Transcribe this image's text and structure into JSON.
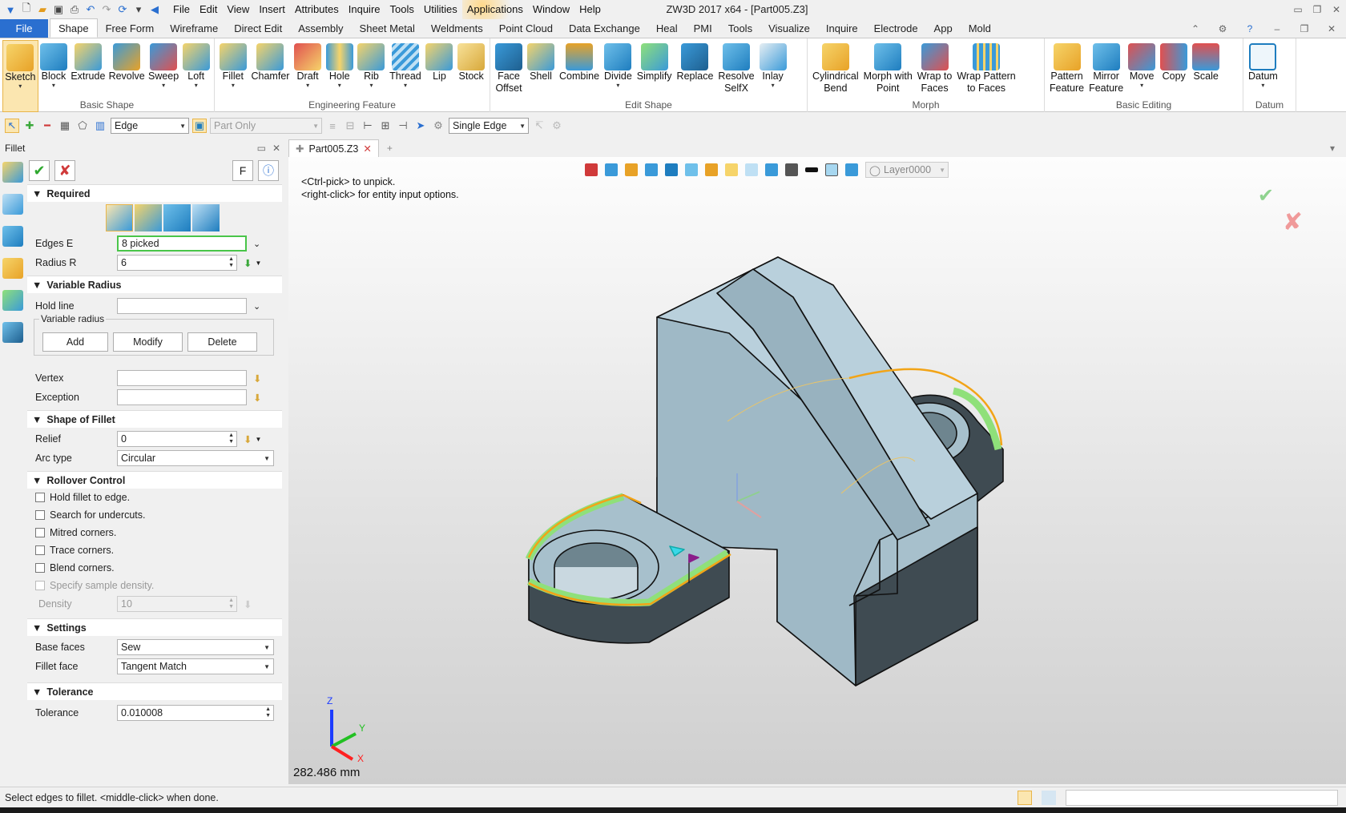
{
  "app": {
    "title": "ZW3D 2017  x64 - [Part005.Z3]",
    "menus": [
      "File",
      "Edit",
      "View",
      "Insert",
      "Attributes",
      "Inquire",
      "Tools",
      "Utilities",
      "Applications",
      "Window",
      "Help"
    ]
  },
  "ribbon_tabs": [
    "File",
    "Shape",
    "Free Form",
    "Wireframe",
    "Direct Edit",
    "Assembly",
    "Sheet Metal",
    "Weldments",
    "Point Cloud",
    "Data Exchange",
    "Heal",
    "PMI",
    "Tools",
    "Visualize",
    "Inquire",
    "Electrode",
    "App",
    "Mold"
  ],
  "ribbon_groups": [
    {
      "label": "Basic Shape",
      "buttons": [
        "Sketch",
        "Block",
        "Extrude",
        "Revolve",
        "Sweep",
        "Loft"
      ]
    },
    {
      "label": "Engineering Feature",
      "buttons": [
        "Fillet",
        "Chamfer",
        "Draft",
        "Hole",
        "Rib",
        "Thread",
        "Lip",
        "Stock"
      ]
    },
    {
      "label": "Edit Shape",
      "buttons": [
        "Face\nOffset",
        "Shell",
        "Combine",
        "Divide",
        "Simplify",
        "Replace",
        "Resolve\nSelfX",
        "Inlay"
      ]
    },
    {
      "label": "Morph",
      "buttons": [
        "Cylindrical\nBend",
        "Morph with\nPoint",
        "Wrap to\nFaces",
        "Wrap Pattern\nto Faces"
      ]
    },
    {
      "label": "Basic Editing",
      "buttons": [
        "Pattern\nFeature",
        "Mirror\nFeature",
        "Move",
        "Copy",
        "Scale"
      ]
    },
    {
      "label": "Datum",
      "buttons": [
        "Datum"
      ]
    }
  ],
  "toolbar": {
    "filter": "Edge",
    "scope": "Part Only",
    "pick_mode": "Single Edge"
  },
  "doc_tab": "Part005.Z3",
  "panel": {
    "title": "Fillet",
    "f_button": "F",
    "sections": {
      "required": "Required",
      "variable_radius": "Variable Radius",
      "shape_of_fillet": "Shape of Fillet",
      "rollover_control": "Rollover Control",
      "settings": "Settings",
      "tolerance": "Tolerance"
    },
    "edges_label": "Edges E",
    "edges_value": "8 picked",
    "radius_label": "Radius R",
    "radius_value": "6",
    "hold_line_label": "Hold line",
    "variable_radius_group": "Variable radius",
    "add": "Add",
    "modify": "Modify",
    "delete": "Delete",
    "vertex_label": "Vertex",
    "exception_label": "Exception",
    "relief_label": "Relief",
    "relief_value": "0",
    "arc_type_label": "Arc type",
    "arc_type_value": "Circular",
    "checks": [
      "Hold fillet to edge.",
      "Search for undercuts.",
      "Mitred corners.",
      "Trace corners.",
      "Blend corners.",
      "Specify sample density."
    ],
    "density_label": "Density",
    "density_value": "10",
    "base_faces_label": "Base faces",
    "base_faces_value": "Sew",
    "fillet_face_label": "Fillet face",
    "fillet_face_value": "Tangent Match",
    "tolerance_label": "Tolerance",
    "tolerance_value": "0.010008"
  },
  "viewport": {
    "hint1": "<Ctrl-pick> to unpick.",
    "hint2": "<right-click> for entity input options.",
    "layer": "Layer0000",
    "scale": "282.486 mm",
    "axis_x": "X",
    "axis_y": "Y",
    "axis_z": "Z"
  },
  "status": "Select edges to fillet.  <middle-click> when done.",
  "colors": {
    "accent": "#2a6fd0",
    "part": "#a7c0cc",
    "part_dark": "#4b5960",
    "fillet_highlight": "#8fe07a",
    "edge_highlight": "#f2a417"
  }
}
